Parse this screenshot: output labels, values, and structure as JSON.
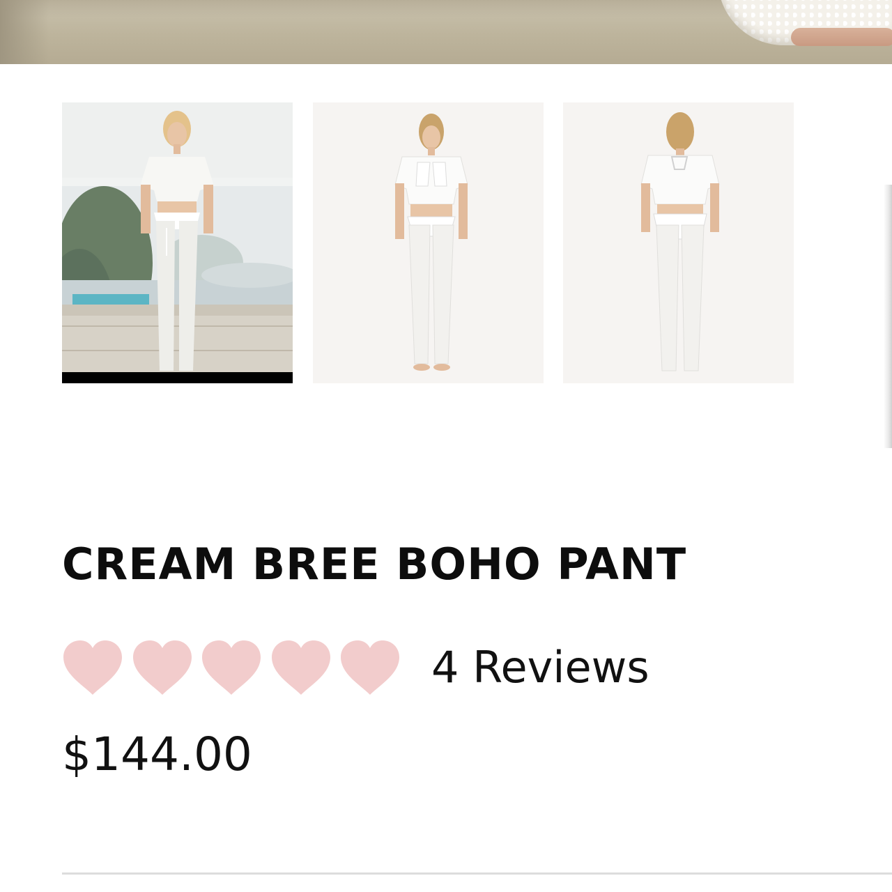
{
  "hero": {
    "image": "product-main-photo-cropped"
  },
  "gallery": {
    "thumbnails": [
      {
        "alt": "product-thumbnail-lifestyle",
        "active": true
      },
      {
        "alt": "product-thumbnail-front",
        "active": false
      },
      {
        "alt": "product-thumbnail-back",
        "active": false
      }
    ]
  },
  "product": {
    "title": "CREAM BREE BOHO PANT",
    "rating": {
      "hearts": 5,
      "icon": "heart-icon",
      "color": "#f2cccc",
      "reviews_label": "4 Reviews"
    },
    "price": "$144.00"
  }
}
